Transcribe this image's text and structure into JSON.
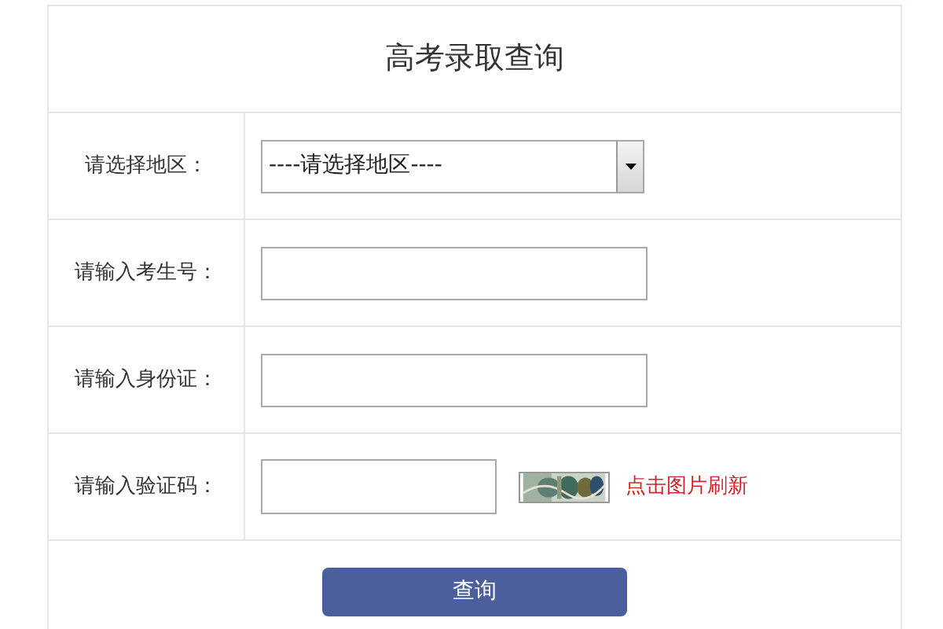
{
  "title": "高考录取查询",
  "fields": [
    {
      "kind": "select",
      "label": "请选择地区：",
      "value": "----请选择地区----"
    },
    {
      "kind": "text",
      "label": "请输入考生号："
    },
    {
      "kind": "text",
      "label": "请输入身份证："
    },
    {
      "kind": "captcha",
      "label": "请输入验证码：",
      "refresh_link": "点击图片刷新"
    }
  ],
  "submit_button": "查询"
}
